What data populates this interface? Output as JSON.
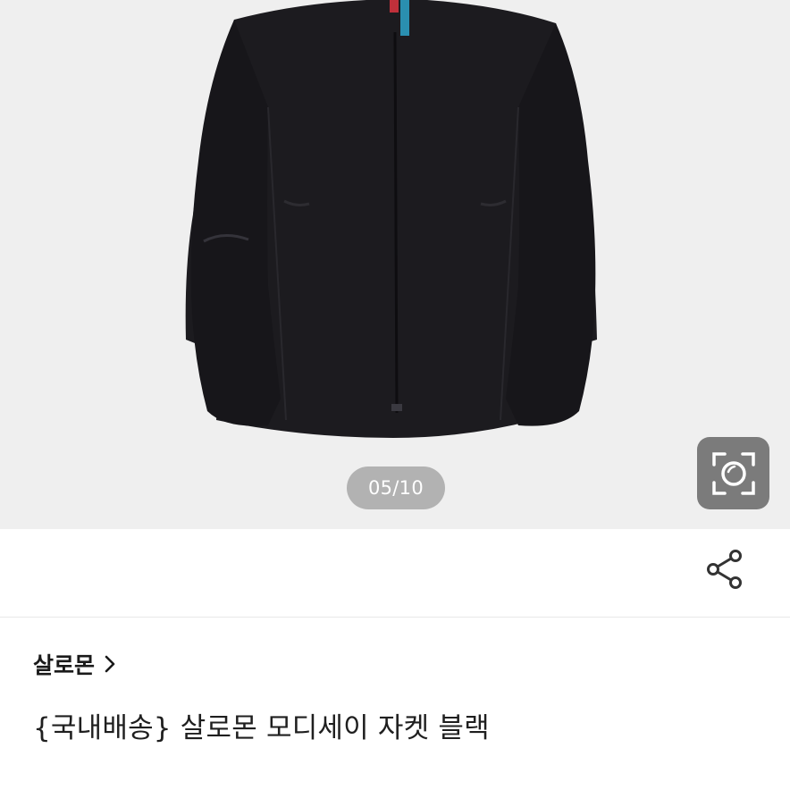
{
  "gallery": {
    "image_name": "jacket-product-photo",
    "counter": "05/10",
    "lens_icon": "camera-lens-icon"
  },
  "actions": {
    "share_icon": "share-icon"
  },
  "product": {
    "brand": "살로몬",
    "brand_icon": "chevron-right-icon",
    "title": "{국내배송} 살로몬 모디세이 자켓 블랙"
  },
  "colors": {
    "gallery_bg": "#efefef",
    "jacket": "#1c1b1f",
    "pill_bg": "#808080",
    "lens_button_bg": "#7b7b7b",
    "text": "#1a1a1a"
  }
}
